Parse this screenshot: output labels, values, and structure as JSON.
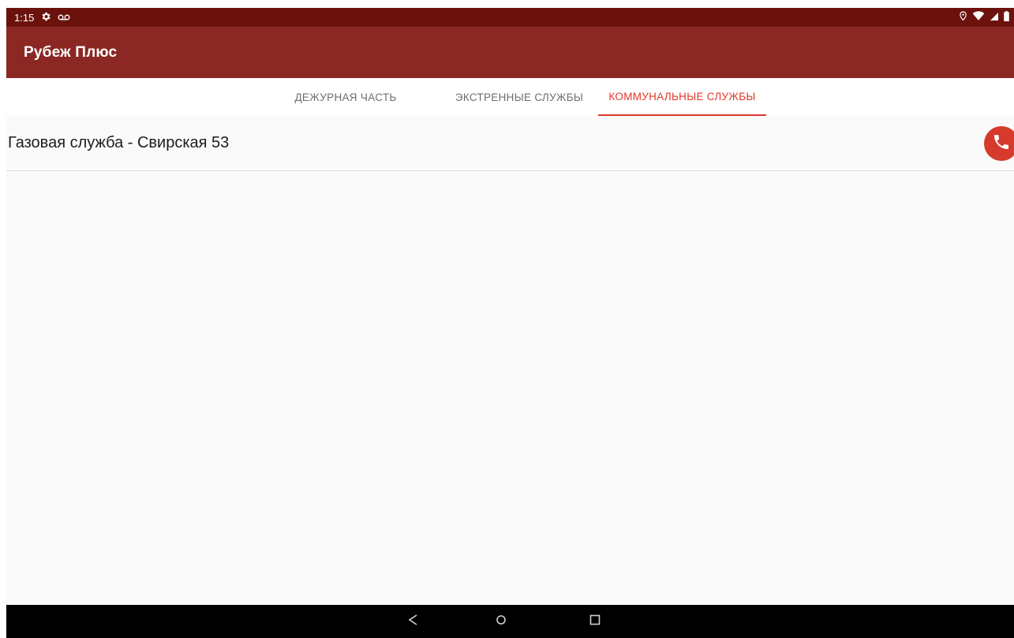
{
  "status_bar": {
    "time": "1:15",
    "left_icons": [
      "gear-icon",
      "voicemail-icon"
    ],
    "right_icons": [
      "location-icon",
      "wifi-icon",
      "signal-icon",
      "battery-icon"
    ]
  },
  "app_bar": {
    "title": "Рубеж Плюс"
  },
  "tabs": [
    {
      "label": "ДЕЖУРНАЯ ЧАСТЬ",
      "active": false
    },
    {
      "label": "ЭКСТРЕННЫЕ СЛУЖБЫ",
      "active": false
    },
    {
      "label": "КОММУНАЛЬНЫЕ СЛУЖБЫ",
      "active": true
    }
  ],
  "list": {
    "items": [
      {
        "label": "Газовая служба - Свирская 53",
        "action_icon": "phone-icon"
      }
    ]
  },
  "nav_bar": {
    "buttons": [
      "back-icon",
      "home-icon",
      "recents-icon"
    ]
  },
  "colors": {
    "status_bar": "#6b120d",
    "app_bar": "#8b2824",
    "accent": "#e0372a",
    "call_button": "#d63a2c"
  }
}
